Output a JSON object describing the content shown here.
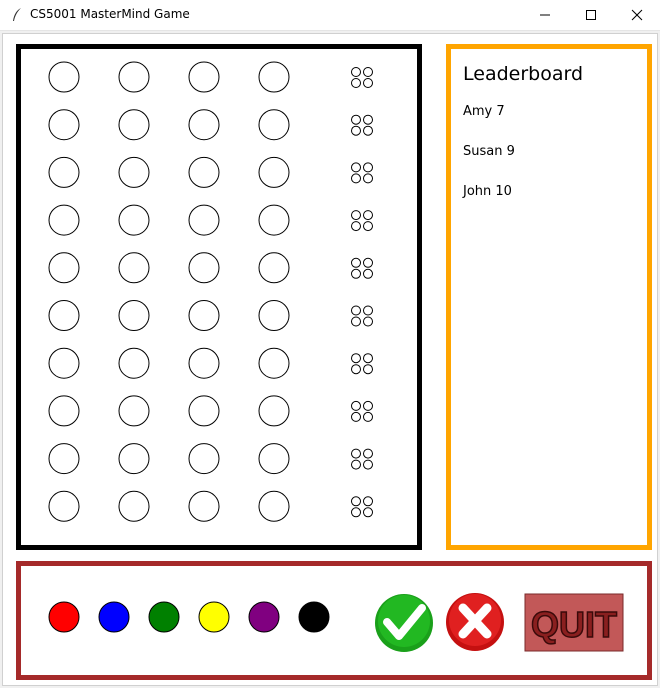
{
  "window": {
    "title": "CS5001 MasterMind Game",
    "buttons": [
      "minimize",
      "maximize",
      "close"
    ]
  },
  "board": {
    "rows": 10,
    "pegs_per_row": 4,
    "feedback_pegs_per_row": 4,
    "border_color": "#000000"
  },
  "leaderboard": {
    "title": "Leaderboard",
    "border_color": "#ffa500",
    "entries": [
      {
        "text": "Amy 7"
      },
      {
        "text": "Susan 9"
      },
      {
        "text": "John 10"
      }
    ]
  },
  "controls": {
    "border_color": "#a52a2a",
    "colors": [
      {
        "name": "red",
        "hex": "#ff0000"
      },
      {
        "name": "blue",
        "hex": "#0000ff"
      },
      {
        "name": "green",
        "hex": "#008000"
      },
      {
        "name": "yellow",
        "hex": "#ffff00"
      },
      {
        "name": "purple",
        "hex": "#800080"
      },
      {
        "name": "black",
        "hex": "#000000"
      }
    ],
    "check_button": {
      "icon": "check-icon",
      "color": "#16a31a"
    },
    "cancel_button": {
      "icon": "x-icon",
      "color": "#d81414"
    },
    "quit_button": {
      "label": "QUIT",
      "color": "#c05a5a"
    }
  }
}
